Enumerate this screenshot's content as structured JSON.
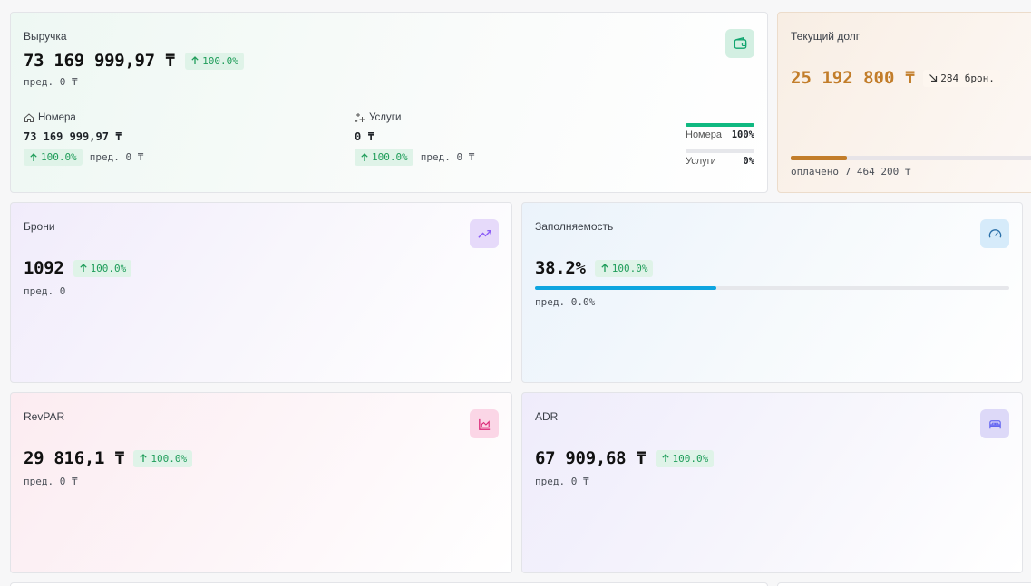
{
  "revenue": {
    "title": "Выручка",
    "value": "73 169 999,97 ₸",
    "change": "100.0%",
    "prev": "пред. 0 ₸",
    "rooms": {
      "label": "Номера",
      "value": "73 169 999,97 ₸",
      "change": "100.0%",
      "prev": "пред. 0 ₸"
    },
    "services": {
      "label": "Услуги",
      "value": "0 ₸",
      "change": "100.0%",
      "prev": "пред. 0 ₸"
    },
    "split": [
      {
        "label": "Номера",
        "percent_text": "100%",
        "share": 1.0
      },
      {
        "label": "Услуги",
        "percent_text": "0%",
        "share": 0.0
      }
    ]
  },
  "debt": {
    "title": "Текущий долг",
    "value": "25 192 800 ₸",
    "bookings": "284 брон.",
    "paid": "оплачено 7 464 200 ₸",
    "paid_share": 0.23
  },
  "bookings": {
    "title": "Брони",
    "value": "1092",
    "change": "100.0%",
    "prev": "пред. 0"
  },
  "occupancy": {
    "title": "Заполняемость",
    "value": "38.2%",
    "change": "100.0%",
    "prev": "пред. 0.0%",
    "level": 0.382
  },
  "revpar": {
    "title": "RevPAR",
    "value": "29 816,1 ₸",
    "change": "100.0%",
    "prev": "пред. 0 ₸"
  },
  "adr": {
    "title": "ADR",
    "value": "67 909,68 ₸",
    "change": "100.0%",
    "prev": "пред. 0 ₸"
  },
  "colors": {
    "green": "#10b981",
    "amber": "#c27d2a",
    "blue": "#0ea5e0",
    "purple": "#8b5cf6",
    "pink": "#db2777",
    "indigo": "#6366f1"
  }
}
